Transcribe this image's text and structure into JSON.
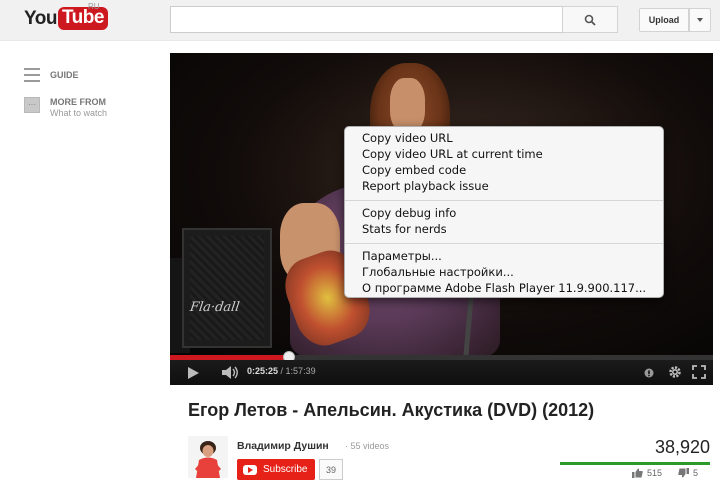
{
  "masthead": {
    "logo_you": "You",
    "logo_tube": "Tube",
    "region": "RU",
    "search_value": "",
    "search_icon": "search-icon",
    "upload_label": "Upload"
  },
  "sidebar": {
    "guide_label": "GUIDE",
    "more_from_title": "MORE FROM",
    "more_from_sub": "What to watch"
  },
  "player": {
    "cab_brand": "Fla·dall",
    "current_time": "0:25:25",
    "duration": "1:57:39",
    "progress_percent": 22,
    "colors": {
      "progress": "#cc181e",
      "background": "#000000"
    },
    "context_menu": {
      "group1": [
        "Copy video URL",
        "Copy video URL at current time",
        "Copy embed code",
        "Report playback issue"
      ],
      "group2": [
        "Copy debug info",
        "Stats for nerds"
      ],
      "group3": [
        "Параметры...",
        "Глобальные настройки...",
        "О программе Adobe Flash Player 11.9.900.117..."
      ]
    }
  },
  "video": {
    "title": "Егор Летов - Апельсин. Акустика (DVD) (2012)",
    "owner": "Владимир Душин",
    "videos_count": "55 videos",
    "subscribe_label": "Subscribe",
    "subscriber_count": "39",
    "views": "38,920",
    "likes": "515",
    "dislikes": "5"
  }
}
